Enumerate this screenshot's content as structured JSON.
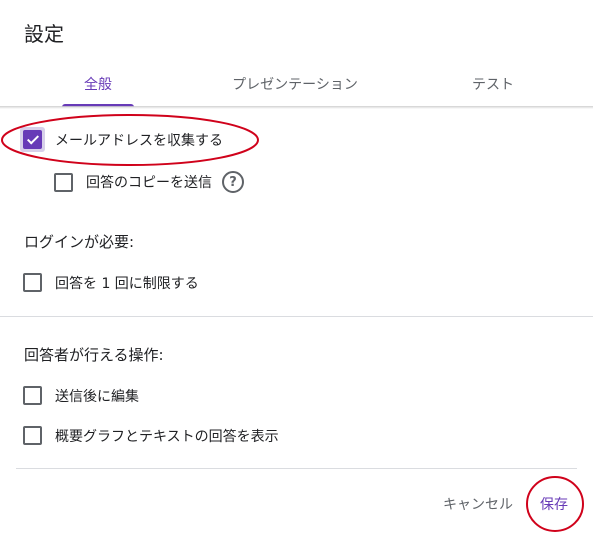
{
  "dialog": {
    "title": "設定",
    "tabs": [
      {
        "label": "全般"
      },
      {
        "label": "プレゼンテーション"
      },
      {
        "label": "テスト"
      }
    ],
    "collect_email_label": "メールアドレスを収集する",
    "send_copy_label": "回答のコピーを送信",
    "help_glyph": "?",
    "login_section_title": "ログインが必要:",
    "limit_one_label": "回答を 1 回に制限する",
    "respondent_section_title": "回答者が行える操作:",
    "edit_after_submit_label": "送信後に編集",
    "summary_chart_label": "概要グラフとテキストの回答を表示",
    "cancel_label": "キャンセル",
    "save_label": "保存",
    "accent_color": "#673ab7",
    "annotation_color": "#d0021b"
  }
}
